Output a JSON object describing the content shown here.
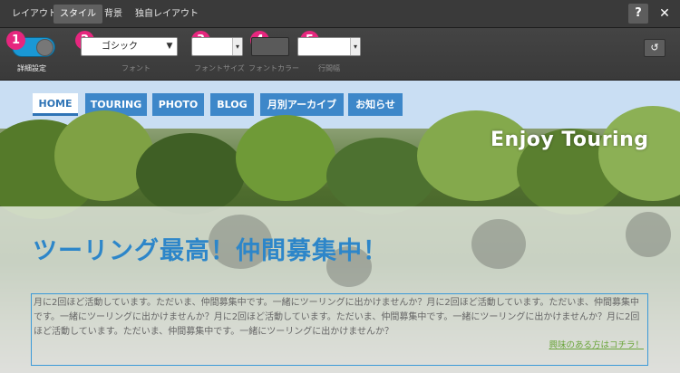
{
  "editor": {
    "tabs": [
      "レイアウト",
      "スタイル",
      "背景",
      "独自レイアウト"
    ],
    "active_tab": "スタイル",
    "help_label": "?",
    "close_label": "✕"
  },
  "toolbar": {
    "badges": [
      "1",
      "2",
      "3",
      "4",
      "5"
    ],
    "advanced_label": "詳細設定",
    "font": {
      "value": "ゴシック",
      "label": "フォント"
    },
    "font_size": {
      "value": "",
      "label": "フォントサイズ"
    },
    "font_color": {
      "value": "#5a5a5a",
      "label": "フォントカラー"
    },
    "line_height": {
      "value": "",
      "label": "行間幅"
    },
    "reset_icon": "reset-icon"
  },
  "site": {
    "nav": [
      "HOME",
      "TOURING",
      "PHOTO",
      "BLOG",
      "月別アーカイブ",
      "お知らせ"
    ],
    "active_nav": "HOME",
    "hero_tagline": "Enjoy Touring",
    "headline": "ツーリング最高！仲間募集中！",
    "body": "月に2回ほど活動しています。ただいま、仲間募集中です。一緒にツーリングに出かけませんか？月に2回ほど活動しています。ただいま、仲間募集中です。一緒にツーリングに出かけませんか？月に2回ほど活動しています。ただいま、仲間募集中です。一緒にツーリングに出かけませんか？月に2回ほど活動しています。ただいま、仲間募集中です。一緒にツーリングに出かけませんか？",
    "more_link": "興味のある方はコチラ！"
  },
  "colors": {
    "accent_pink": "#e6267e",
    "toggle_blue": "#1a98d5",
    "brand_blue": "#2d86c9",
    "link_green": "#6aa53a"
  }
}
